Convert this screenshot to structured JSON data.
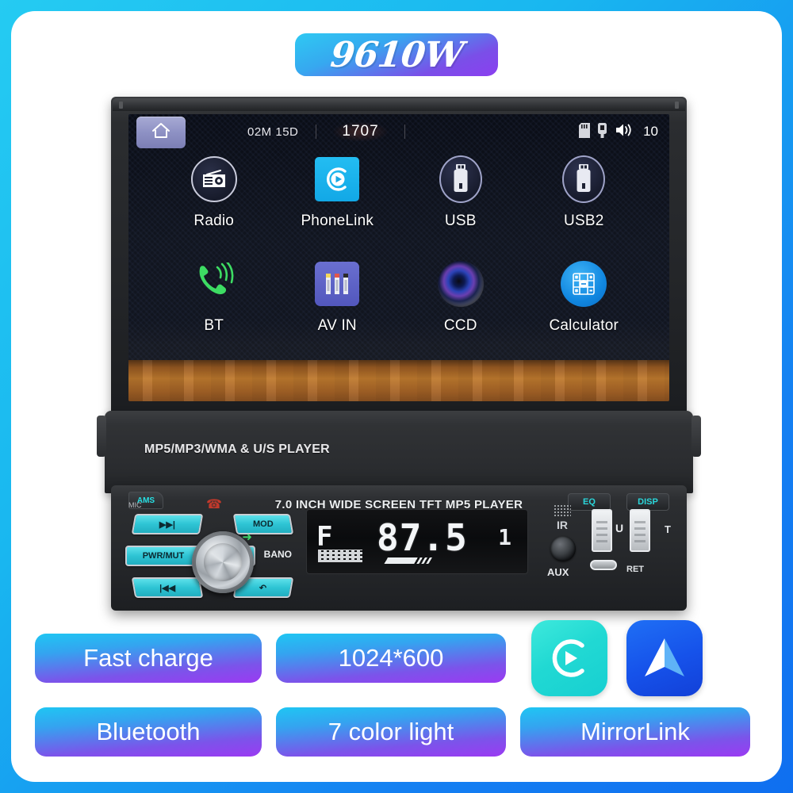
{
  "title": {
    "model": "9610W"
  },
  "unit": {
    "screen": {
      "statusbar": {
        "home_icon": "home-icon",
        "date": "02M 15D",
        "time": "1707",
        "sd_icon": "sd-card-icon",
        "usb_icon": "usb-icon",
        "volume_icon": "speaker-icon",
        "volume_level": "10"
      },
      "apps": [
        {
          "label": "Radio",
          "icon": "radio-icon"
        },
        {
          "label": "PhoneLink",
          "icon": "play-circle-icon"
        },
        {
          "label": "USB",
          "icon": "usb-stick-icon"
        },
        {
          "label": "USB2",
          "icon": "usb-stick-icon"
        },
        {
          "label": "BT",
          "icon": "bluetooth-phone-icon"
        },
        {
          "label": "AV IN",
          "icon": "rca-connectors-icon"
        },
        {
          "label": "CCD",
          "icon": "camera-lens-icon"
        },
        {
          "label": "Calculator",
          "icon": "calculator-icon"
        }
      ]
    },
    "faceplate": {
      "model_line": "MP5/MP3/WMA & U/S PLAYER"
    },
    "panel": {
      "title": "7.0 INCH WIDE SCREEN TFT MP5 PLAYER",
      "ams_label": "AMS",
      "eq_label": "EQ",
      "disp_label": "DISP",
      "mic_label": "MIC",
      "band_label": "BANO",
      "keys": {
        "next": "▶▶|",
        "power_mute": "PWR/MUT",
        "prev": "|◀◀",
        "mod": "MOD",
        "band": "",
        "return": "↶"
      },
      "display": {
        "band": "F",
        "frequency": "87.5",
        "channel": "1"
      },
      "io": {
        "aux_label": "AUX",
        "usb_letter": "U",
        "t_letter": "T",
        "ret_label": "RET",
        "ir_label": "IR"
      }
    }
  },
  "features": {
    "row1": [
      {
        "label": "Fast charge"
      },
      {
        "label": "1024*600"
      }
    ],
    "row2": [
      {
        "label": "Bluetooth"
      },
      {
        "label": "7 color light"
      },
      {
        "label": "MirrorLink"
      }
    ],
    "logos": [
      {
        "name": "carplay-logo"
      },
      {
        "name": "android-auto-logo"
      }
    ]
  },
  "colors": {
    "frame_cyan": "#22c8f0",
    "frame_blue": "#1276f0",
    "badge_start": "#1fc6f3",
    "badge_end": "#9b3af2",
    "key_cyan": "#2ec4d4",
    "lcd_bg": "#11151f"
  }
}
